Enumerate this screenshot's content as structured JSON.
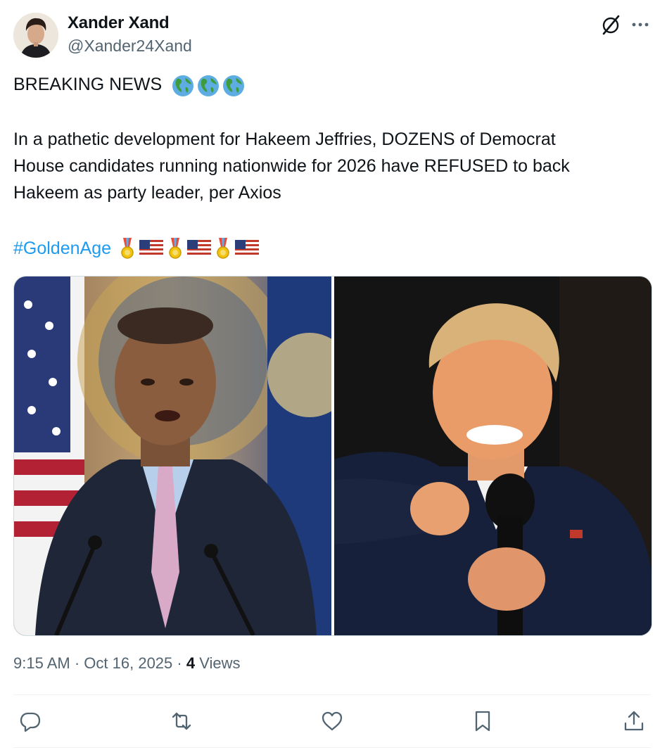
{
  "author": {
    "display_name": "Xander Xand",
    "handle": "@Xander24Xand"
  },
  "tweet": {
    "headline": "BREAKING NEWS",
    "headline_emojis": [
      "earth-globe-americas",
      "earth-globe-americas",
      "earth-globe-americas"
    ],
    "body_lines": [
      "In a pathetic development for Hakeem Jeffries, DOZENS of Democrat",
      "House candidates running nationwide for 2026 have REFUSED to back",
      "Hakeem as party leader, per Axios"
    ],
    "hashtag": "#GoldenAge",
    "hashtag_emojis": [
      "military-medal",
      "us-flag",
      "military-medal",
      "us-flag",
      "military-medal",
      "us-flag"
    ]
  },
  "media": {
    "count": 2
  },
  "meta": {
    "time": "9:15 AM",
    "separator": "·",
    "date": "Oct 16, 2025",
    "views_count": "4",
    "views_label": "Views"
  },
  "actions": [
    "reply-icon",
    "retweet-icon",
    "like-icon",
    "bookmark-icon",
    "share-icon"
  ],
  "colors": {
    "link": "#1d9bf0",
    "secondary_text": "#536471",
    "primary_text": "#0f1419",
    "divider": "#eff3f4"
  }
}
